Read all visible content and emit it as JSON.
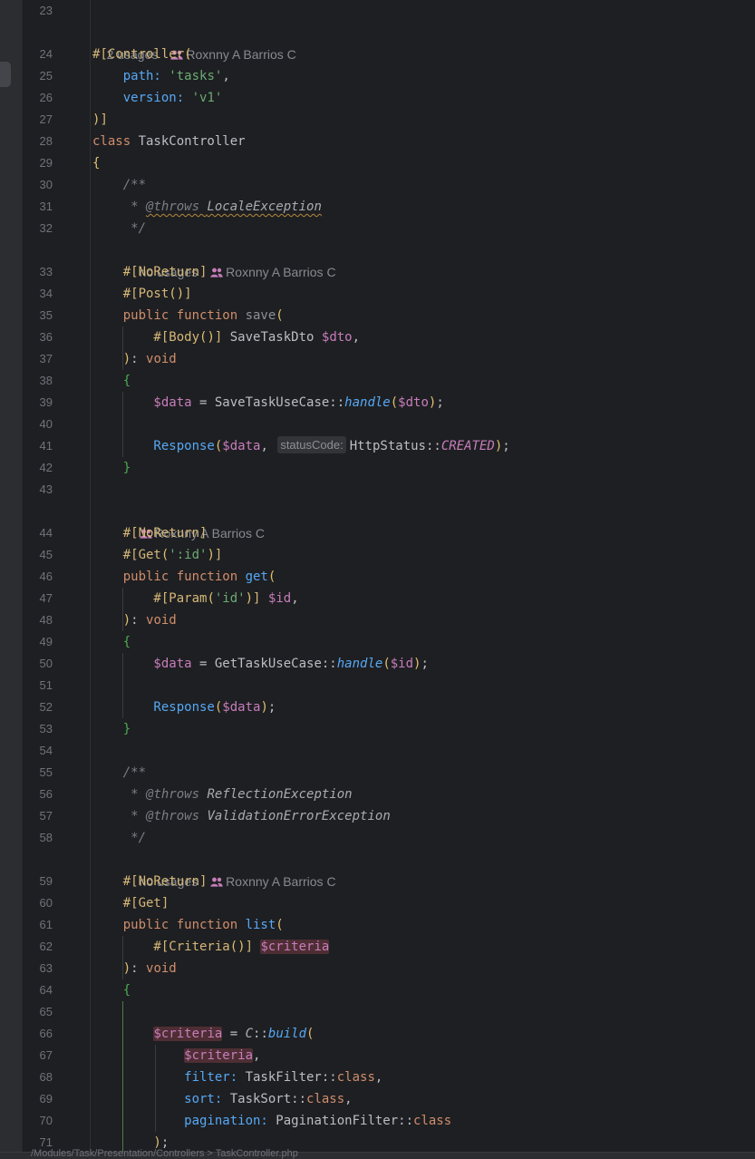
{
  "editor": {
    "language": "PHP",
    "colors": {
      "background": "#1e1f22",
      "keyword": "#cf8e6d",
      "string": "#6aab73",
      "variable": "#c77dbb",
      "function": "#56a8f5",
      "comment": "#7a7e85",
      "line_number": "#6f737a"
    }
  },
  "hints": {
    "h_controller": {
      "usages": "2 usages",
      "author": "Roxnny A Barrios C"
    },
    "h_save": {
      "usages": "no usages",
      "author": "Roxnny A Barrios C"
    },
    "h_get": {
      "usages": "",
      "author": "Roxnny A Barrios C"
    },
    "h_list": {
      "usages": "no usages",
      "author": "Roxnny A Barrios C"
    }
  },
  "inlay_hints": {
    "status_code": "statusCode:"
  },
  "lines": [
    {
      "n": "23",
      "tokens": []
    },
    {
      "n": "24",
      "tokens": [
        [
          "attr",
          "#[Controller"
        ],
        [
          "brk",
          "("
        ]
      ]
    },
    {
      "n": "25",
      "tokens": [
        [
          "named",
          "    path: "
        ],
        [
          "str",
          "'tasks'"
        ],
        [
          "cls",
          ","
        ]
      ]
    },
    {
      "n": "26",
      "tokens": [
        [
          "named",
          "    version: "
        ],
        [
          "str",
          "'v1'"
        ]
      ]
    },
    {
      "n": "27",
      "tokens": [
        [
          "brk",
          ")"
        ],
        [
          "attr",
          "]"
        ]
      ]
    },
    {
      "n": "28",
      "tokens": [
        [
          "kw",
          "class "
        ],
        [
          "cls",
          "TaskController"
        ]
      ]
    },
    {
      "n": "29",
      "tokens": [
        [
          "brk",
          "{"
        ]
      ]
    },
    {
      "n": "30",
      "tokens": [
        [
          "cmt",
          "    /**"
        ]
      ]
    },
    {
      "n": "31",
      "tokens": [
        [
          "cmt",
          "     * "
        ],
        [
          "cmt-tag wavy",
          "@throws "
        ],
        [
          "cmt-ty wavy",
          "LocaleException"
        ]
      ]
    },
    {
      "n": "32",
      "tokens": [
        [
          "cmt",
          "     */"
        ]
      ]
    },
    {
      "n": "33",
      "tokens": [
        [
          "attr",
          "    #[NoReturn]"
        ]
      ]
    },
    {
      "n": "34",
      "tokens": [
        [
          "attr",
          "    #[Post"
        ],
        [
          "brk",
          "()"
        ],
        [
          "attr",
          "]"
        ]
      ]
    },
    {
      "n": "35",
      "tokens": [
        [
          "kw",
          "    public function "
        ],
        [
          "fn-gray",
          "save"
        ],
        [
          "brk",
          "("
        ]
      ]
    },
    {
      "n": "36",
      "tokens": [
        [
          "attr",
          "        #[Body"
        ],
        [
          "brk",
          "()"
        ],
        [
          "attr",
          "] "
        ],
        [
          "cls",
          "SaveTaskDto "
        ],
        [
          "var",
          "$dto"
        ],
        [
          "cls",
          ","
        ]
      ]
    },
    {
      "n": "37",
      "tokens": [
        [
          "brk",
          "    )"
        ],
        [
          "cls",
          ": "
        ],
        [
          "kw",
          "void"
        ]
      ]
    },
    {
      "n": "38",
      "tokens": [
        [
          "brc",
          "    {"
        ]
      ]
    },
    {
      "n": "39",
      "tokens": [
        [
          "var",
          "        $data"
        ],
        [
          "cls",
          " = SaveTaskUseCase::"
        ],
        [
          "static",
          "handle"
        ],
        [
          "brk",
          "("
        ],
        [
          "var",
          "$dto"
        ],
        [
          "brk",
          ")"
        ],
        [
          "cls",
          ";"
        ]
      ]
    },
    {
      "n": "40",
      "tokens": []
    },
    {
      "n": "41",
      "tokens": [
        [
          "fn",
          "        Response"
        ],
        [
          "brk",
          "("
        ],
        [
          "var",
          "$data"
        ],
        [
          "cls",
          ", "
        ],
        [
          "inlay",
          "statusCode:"
        ],
        [
          "cls",
          "HttpStatus::"
        ],
        [
          "const",
          "CREATED"
        ],
        [
          "brk",
          ")"
        ],
        [
          "cls",
          ";"
        ]
      ]
    },
    {
      "n": "42",
      "tokens": [
        [
          "brc",
          "    }"
        ]
      ]
    },
    {
      "n": "43",
      "tokens": []
    },
    {
      "n": "44",
      "tokens": [
        [
          "attr",
          "    #[NoReturn]"
        ]
      ]
    },
    {
      "n": "45",
      "tokens": [
        [
          "attr",
          "    #[Get"
        ],
        [
          "brk",
          "("
        ],
        [
          "str",
          "':id'"
        ],
        [
          "brk",
          ")"
        ],
        [
          "attr",
          "]"
        ]
      ]
    },
    {
      "n": "46",
      "tokens": [
        [
          "kw",
          "    public function "
        ],
        [
          "fn",
          "get"
        ],
        [
          "brk",
          "("
        ]
      ]
    },
    {
      "n": "47",
      "tokens": [
        [
          "attr",
          "        #[Param"
        ],
        [
          "brk",
          "("
        ],
        [
          "str",
          "'id'"
        ],
        [
          "brk",
          ")"
        ],
        [
          "attr",
          "] "
        ],
        [
          "var",
          "$id"
        ],
        [
          "cls",
          ","
        ]
      ]
    },
    {
      "n": "48",
      "tokens": [
        [
          "brk",
          "    )"
        ],
        [
          "cls",
          ": "
        ],
        [
          "kw",
          "void"
        ]
      ]
    },
    {
      "n": "49",
      "tokens": [
        [
          "brc",
          "    {"
        ]
      ]
    },
    {
      "n": "50",
      "tokens": [
        [
          "var",
          "        $data"
        ],
        [
          "cls",
          " = GetTaskUseCase::"
        ],
        [
          "static",
          "handle"
        ],
        [
          "brk",
          "("
        ],
        [
          "var",
          "$id"
        ],
        [
          "brk",
          ")"
        ],
        [
          "cls",
          ";"
        ]
      ]
    },
    {
      "n": "51",
      "tokens": []
    },
    {
      "n": "52",
      "tokens": [
        [
          "fn",
          "        Response"
        ],
        [
          "brk",
          "("
        ],
        [
          "var",
          "$data"
        ],
        [
          "brk",
          ")"
        ],
        [
          "cls",
          ";"
        ]
      ]
    },
    {
      "n": "53",
      "tokens": [
        [
          "brc",
          "    }"
        ]
      ]
    },
    {
      "n": "54",
      "tokens": []
    },
    {
      "n": "55",
      "tokens": [
        [
          "cmt",
          "    /**"
        ]
      ]
    },
    {
      "n": "56",
      "tokens": [
        [
          "cmt",
          "     * "
        ],
        [
          "cmt-tag",
          "@throws "
        ],
        [
          "cmt-ty",
          "ReflectionException"
        ]
      ]
    },
    {
      "n": "57",
      "tokens": [
        [
          "cmt",
          "     * "
        ],
        [
          "cmt-tag",
          "@throws "
        ],
        [
          "cmt-ty",
          "ValidationErrorException"
        ]
      ]
    },
    {
      "n": "58",
      "tokens": [
        [
          "cmt",
          "     */"
        ]
      ]
    },
    {
      "n": "59",
      "tokens": [
        [
          "attr",
          "    #[NoReturn]"
        ]
      ]
    },
    {
      "n": "60",
      "tokens": [
        [
          "attr",
          "    #[Get]"
        ]
      ]
    },
    {
      "n": "61",
      "tokens": [
        [
          "kw",
          "    public function "
        ],
        [
          "fn",
          "list"
        ],
        [
          "brk",
          "("
        ]
      ]
    },
    {
      "n": "62",
      "tokens": [
        [
          "attr",
          "        #[Criteria"
        ],
        [
          "brk",
          "()"
        ],
        [
          "attr",
          "] "
        ],
        [
          "var hl",
          "$criteria"
        ]
      ]
    },
    {
      "n": "63",
      "tokens": [
        [
          "brk",
          "    )"
        ],
        [
          "cls",
          ": "
        ],
        [
          "kw",
          "void"
        ]
      ]
    },
    {
      "n": "64",
      "tokens": [
        [
          "brc",
          "    {"
        ]
      ]
    },
    {
      "n": "65",
      "tokens": []
    },
    {
      "n": "66",
      "tokens": [
        [
          "cls",
          "        "
        ],
        [
          "var hl",
          "$criteria"
        ],
        [
          "cls",
          " = "
        ],
        [
          "cmt-ty",
          "C"
        ],
        [
          "cls",
          "::"
        ],
        [
          "static",
          "build"
        ],
        [
          "brk",
          "("
        ]
      ]
    },
    {
      "n": "67",
      "tokens": [
        [
          "cls",
          "            "
        ],
        [
          "var hl",
          "$criteria"
        ],
        [
          "cls",
          ","
        ]
      ]
    },
    {
      "n": "68",
      "tokens": [
        [
          "named",
          "            filter: "
        ],
        [
          "cls",
          "TaskFilter::"
        ],
        [
          "kw",
          "class"
        ],
        [
          "cls",
          ","
        ]
      ]
    },
    {
      "n": "69",
      "tokens": [
        [
          "named",
          "            sort: "
        ],
        [
          "cls",
          "TaskSort::"
        ],
        [
          "kw",
          "class"
        ],
        [
          "cls",
          ","
        ]
      ]
    },
    {
      "n": "70",
      "tokens": [
        [
          "named",
          "            pagination: "
        ],
        [
          "cls",
          "PaginationFilter::"
        ],
        [
          "kw",
          "class"
        ]
      ]
    },
    {
      "n": "71",
      "tokens": [
        [
          "brk",
          "        )"
        ],
        [
          "cls",
          ";"
        ]
      ]
    }
  ],
  "status_bar": {
    "path": "/Modules/Task/Presentation/Controllers > TaskController.php"
  }
}
